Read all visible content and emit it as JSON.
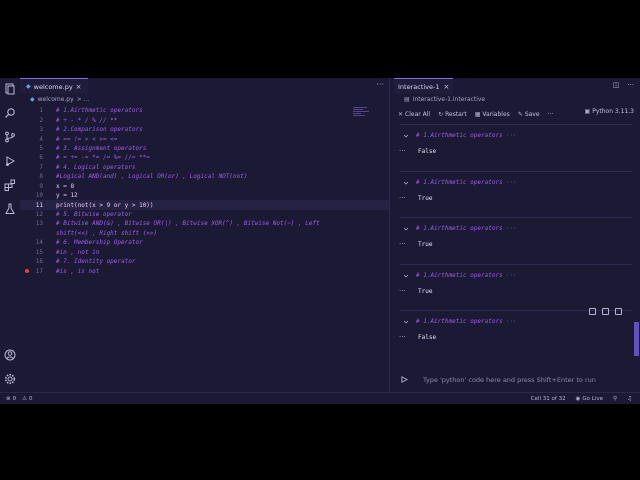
{
  "editor": {
    "tab_label": "welcome.py",
    "tab_icon": "python-file-icon",
    "more": "···",
    "breadcrumb": [
      "welcome.py",
      "> ..."
    ],
    "lines": [
      {
        "n": "1",
        "text": "# 1.Airthmetic operators",
        "kind": "cmt"
      },
      {
        "n": "2",
        "text": "# + - * / % // **",
        "kind": "cmt"
      },
      {
        "n": "3",
        "text": "# 2.Comparison operators",
        "kind": "cmt"
      },
      {
        "n": "4",
        "text": "# == != > < >= <=",
        "kind": "cmt"
      },
      {
        "n": "5",
        "text": "# 3. Assignment operators",
        "kind": "cmt"
      },
      {
        "n": "6",
        "text": "# = += -= *= /= %= //= **=",
        "kind": "cmt"
      },
      {
        "n": "7",
        "text": "# 4. Logical operators",
        "kind": "cmt"
      },
      {
        "n": "8",
        "text": "#Logical AND(and) , Logical OR(or) , Logical NOT(not)",
        "kind": "cmt"
      },
      {
        "n": "9",
        "text": "x = 8",
        "kind": "plain"
      },
      {
        "n": "10",
        "text": "y = 12",
        "kind": "plain"
      },
      {
        "n": "11",
        "text": "print(not(x > 9 or y > 10))",
        "kind": "plain",
        "current": true
      },
      {
        "n": "12",
        "text": "# 5. Bitwise operator",
        "kind": "cmt"
      },
      {
        "n": "13",
        "text": "# Bitwise AND(&) , Bitwise OR(|) , Bitwise XOR(^) , Bitwise Not(~) , Left",
        "kind": "cmt"
      },
      {
        "n": "",
        "text": "shift(<<) , Right shift (>>)",
        "kind": "cmt"
      },
      {
        "n": "14",
        "text": "# 6. Membership Operator",
        "kind": "cmt"
      },
      {
        "n": "15",
        "text": "#in , not in",
        "kind": "cmt"
      },
      {
        "n": "16",
        "text": "# 7. Identity operator",
        "kind": "cmt"
      },
      {
        "n": "17",
        "text": "#is , is not",
        "kind": "cmt",
        "breakpoint": true
      }
    ]
  },
  "interactive": {
    "tab_label": "Interactive-1",
    "breadcrumb": "Interactive-1.interactive",
    "toolbar": {
      "clear_all": "Clear All",
      "restart": "Restart",
      "variables": "Variables",
      "save": "Save",
      "more": "···"
    },
    "kernel": "Python 3.11.3",
    "cells": [
      {
        "input": "# 1.Airthmetic operators",
        "fold": "···",
        "output": "False"
      },
      {
        "input": "# 1.Airthmetic operators",
        "fold": "···",
        "output": "True"
      },
      {
        "input": "# 1.Airthmetic operators",
        "fold": "···",
        "output": "True"
      },
      {
        "input": "# 1.Airthmetic operators",
        "fold": "···",
        "output": "True"
      },
      {
        "input": "# 1.Airthmetic operators",
        "fold": "···",
        "output": "False"
      }
    ],
    "cell_dots": "···",
    "input_placeholder": "Type 'python' code here and press Shift+Enter to run"
  },
  "status": {
    "errors": "0",
    "warnings": "0",
    "cell": "Cell 31 of 32",
    "go_live": "Go Live"
  },
  "colors": {
    "background": "#1b1933",
    "comment": "#a05cf0",
    "code": "#f0c8ff",
    "accent": "#7c6cf0",
    "breakpoint": "#e0443c"
  }
}
